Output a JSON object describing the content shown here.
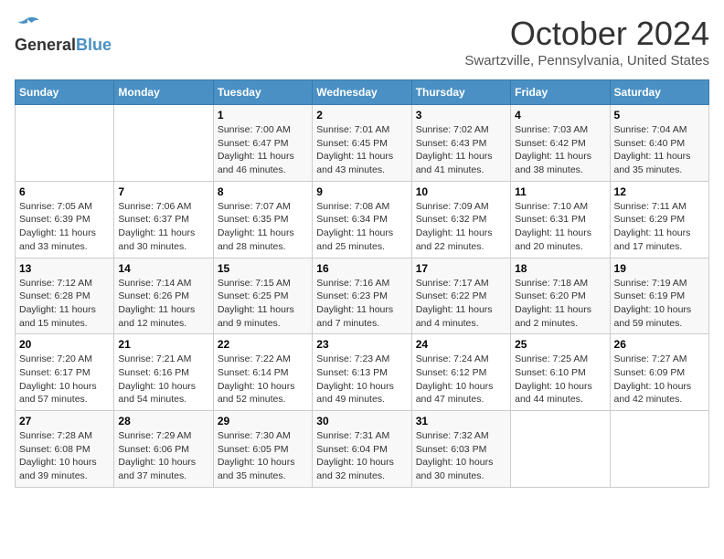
{
  "header": {
    "logo_general": "General",
    "logo_blue": "Blue",
    "month_title": "October 2024",
    "location": "Swartzville, Pennsylvania, United States"
  },
  "weekdays": [
    "Sunday",
    "Monday",
    "Tuesday",
    "Wednesday",
    "Thursday",
    "Friday",
    "Saturday"
  ],
  "weeks": [
    [
      {
        "day": "",
        "sunrise": "",
        "sunset": "",
        "daylight": ""
      },
      {
        "day": "",
        "sunrise": "",
        "sunset": "",
        "daylight": ""
      },
      {
        "day": "1",
        "sunrise": "Sunrise: 7:00 AM",
        "sunset": "Sunset: 6:47 PM",
        "daylight": "Daylight: 11 hours and 46 minutes."
      },
      {
        "day": "2",
        "sunrise": "Sunrise: 7:01 AM",
        "sunset": "Sunset: 6:45 PM",
        "daylight": "Daylight: 11 hours and 43 minutes."
      },
      {
        "day": "3",
        "sunrise": "Sunrise: 7:02 AM",
        "sunset": "Sunset: 6:43 PM",
        "daylight": "Daylight: 11 hours and 41 minutes."
      },
      {
        "day": "4",
        "sunrise": "Sunrise: 7:03 AM",
        "sunset": "Sunset: 6:42 PM",
        "daylight": "Daylight: 11 hours and 38 minutes."
      },
      {
        "day": "5",
        "sunrise": "Sunrise: 7:04 AM",
        "sunset": "Sunset: 6:40 PM",
        "daylight": "Daylight: 11 hours and 35 minutes."
      }
    ],
    [
      {
        "day": "6",
        "sunrise": "Sunrise: 7:05 AM",
        "sunset": "Sunset: 6:39 PM",
        "daylight": "Daylight: 11 hours and 33 minutes."
      },
      {
        "day": "7",
        "sunrise": "Sunrise: 7:06 AM",
        "sunset": "Sunset: 6:37 PM",
        "daylight": "Daylight: 11 hours and 30 minutes."
      },
      {
        "day": "8",
        "sunrise": "Sunrise: 7:07 AM",
        "sunset": "Sunset: 6:35 PM",
        "daylight": "Daylight: 11 hours and 28 minutes."
      },
      {
        "day": "9",
        "sunrise": "Sunrise: 7:08 AM",
        "sunset": "Sunset: 6:34 PM",
        "daylight": "Daylight: 11 hours and 25 minutes."
      },
      {
        "day": "10",
        "sunrise": "Sunrise: 7:09 AM",
        "sunset": "Sunset: 6:32 PM",
        "daylight": "Daylight: 11 hours and 22 minutes."
      },
      {
        "day": "11",
        "sunrise": "Sunrise: 7:10 AM",
        "sunset": "Sunset: 6:31 PM",
        "daylight": "Daylight: 11 hours and 20 minutes."
      },
      {
        "day": "12",
        "sunrise": "Sunrise: 7:11 AM",
        "sunset": "Sunset: 6:29 PM",
        "daylight": "Daylight: 11 hours and 17 minutes."
      }
    ],
    [
      {
        "day": "13",
        "sunrise": "Sunrise: 7:12 AM",
        "sunset": "Sunset: 6:28 PM",
        "daylight": "Daylight: 11 hours and 15 minutes."
      },
      {
        "day": "14",
        "sunrise": "Sunrise: 7:14 AM",
        "sunset": "Sunset: 6:26 PM",
        "daylight": "Daylight: 11 hours and 12 minutes."
      },
      {
        "day": "15",
        "sunrise": "Sunrise: 7:15 AM",
        "sunset": "Sunset: 6:25 PM",
        "daylight": "Daylight: 11 hours and 9 minutes."
      },
      {
        "day": "16",
        "sunrise": "Sunrise: 7:16 AM",
        "sunset": "Sunset: 6:23 PM",
        "daylight": "Daylight: 11 hours and 7 minutes."
      },
      {
        "day": "17",
        "sunrise": "Sunrise: 7:17 AM",
        "sunset": "Sunset: 6:22 PM",
        "daylight": "Daylight: 11 hours and 4 minutes."
      },
      {
        "day": "18",
        "sunrise": "Sunrise: 7:18 AM",
        "sunset": "Sunset: 6:20 PM",
        "daylight": "Daylight: 11 hours and 2 minutes."
      },
      {
        "day": "19",
        "sunrise": "Sunrise: 7:19 AM",
        "sunset": "Sunset: 6:19 PM",
        "daylight": "Daylight: 10 hours and 59 minutes."
      }
    ],
    [
      {
        "day": "20",
        "sunrise": "Sunrise: 7:20 AM",
        "sunset": "Sunset: 6:17 PM",
        "daylight": "Daylight: 10 hours and 57 minutes."
      },
      {
        "day": "21",
        "sunrise": "Sunrise: 7:21 AM",
        "sunset": "Sunset: 6:16 PM",
        "daylight": "Daylight: 10 hours and 54 minutes."
      },
      {
        "day": "22",
        "sunrise": "Sunrise: 7:22 AM",
        "sunset": "Sunset: 6:14 PM",
        "daylight": "Daylight: 10 hours and 52 minutes."
      },
      {
        "day": "23",
        "sunrise": "Sunrise: 7:23 AM",
        "sunset": "Sunset: 6:13 PM",
        "daylight": "Daylight: 10 hours and 49 minutes."
      },
      {
        "day": "24",
        "sunrise": "Sunrise: 7:24 AM",
        "sunset": "Sunset: 6:12 PM",
        "daylight": "Daylight: 10 hours and 47 minutes."
      },
      {
        "day": "25",
        "sunrise": "Sunrise: 7:25 AM",
        "sunset": "Sunset: 6:10 PM",
        "daylight": "Daylight: 10 hours and 44 minutes."
      },
      {
        "day": "26",
        "sunrise": "Sunrise: 7:27 AM",
        "sunset": "Sunset: 6:09 PM",
        "daylight": "Daylight: 10 hours and 42 minutes."
      }
    ],
    [
      {
        "day": "27",
        "sunrise": "Sunrise: 7:28 AM",
        "sunset": "Sunset: 6:08 PM",
        "daylight": "Daylight: 10 hours and 39 minutes."
      },
      {
        "day": "28",
        "sunrise": "Sunrise: 7:29 AM",
        "sunset": "Sunset: 6:06 PM",
        "daylight": "Daylight: 10 hours and 37 minutes."
      },
      {
        "day": "29",
        "sunrise": "Sunrise: 7:30 AM",
        "sunset": "Sunset: 6:05 PM",
        "daylight": "Daylight: 10 hours and 35 minutes."
      },
      {
        "day": "30",
        "sunrise": "Sunrise: 7:31 AM",
        "sunset": "Sunset: 6:04 PM",
        "daylight": "Daylight: 10 hours and 32 minutes."
      },
      {
        "day": "31",
        "sunrise": "Sunrise: 7:32 AM",
        "sunset": "Sunset: 6:03 PM",
        "daylight": "Daylight: 10 hours and 30 minutes."
      },
      {
        "day": "",
        "sunrise": "",
        "sunset": "",
        "daylight": ""
      },
      {
        "day": "",
        "sunrise": "",
        "sunset": "",
        "daylight": ""
      }
    ]
  ]
}
